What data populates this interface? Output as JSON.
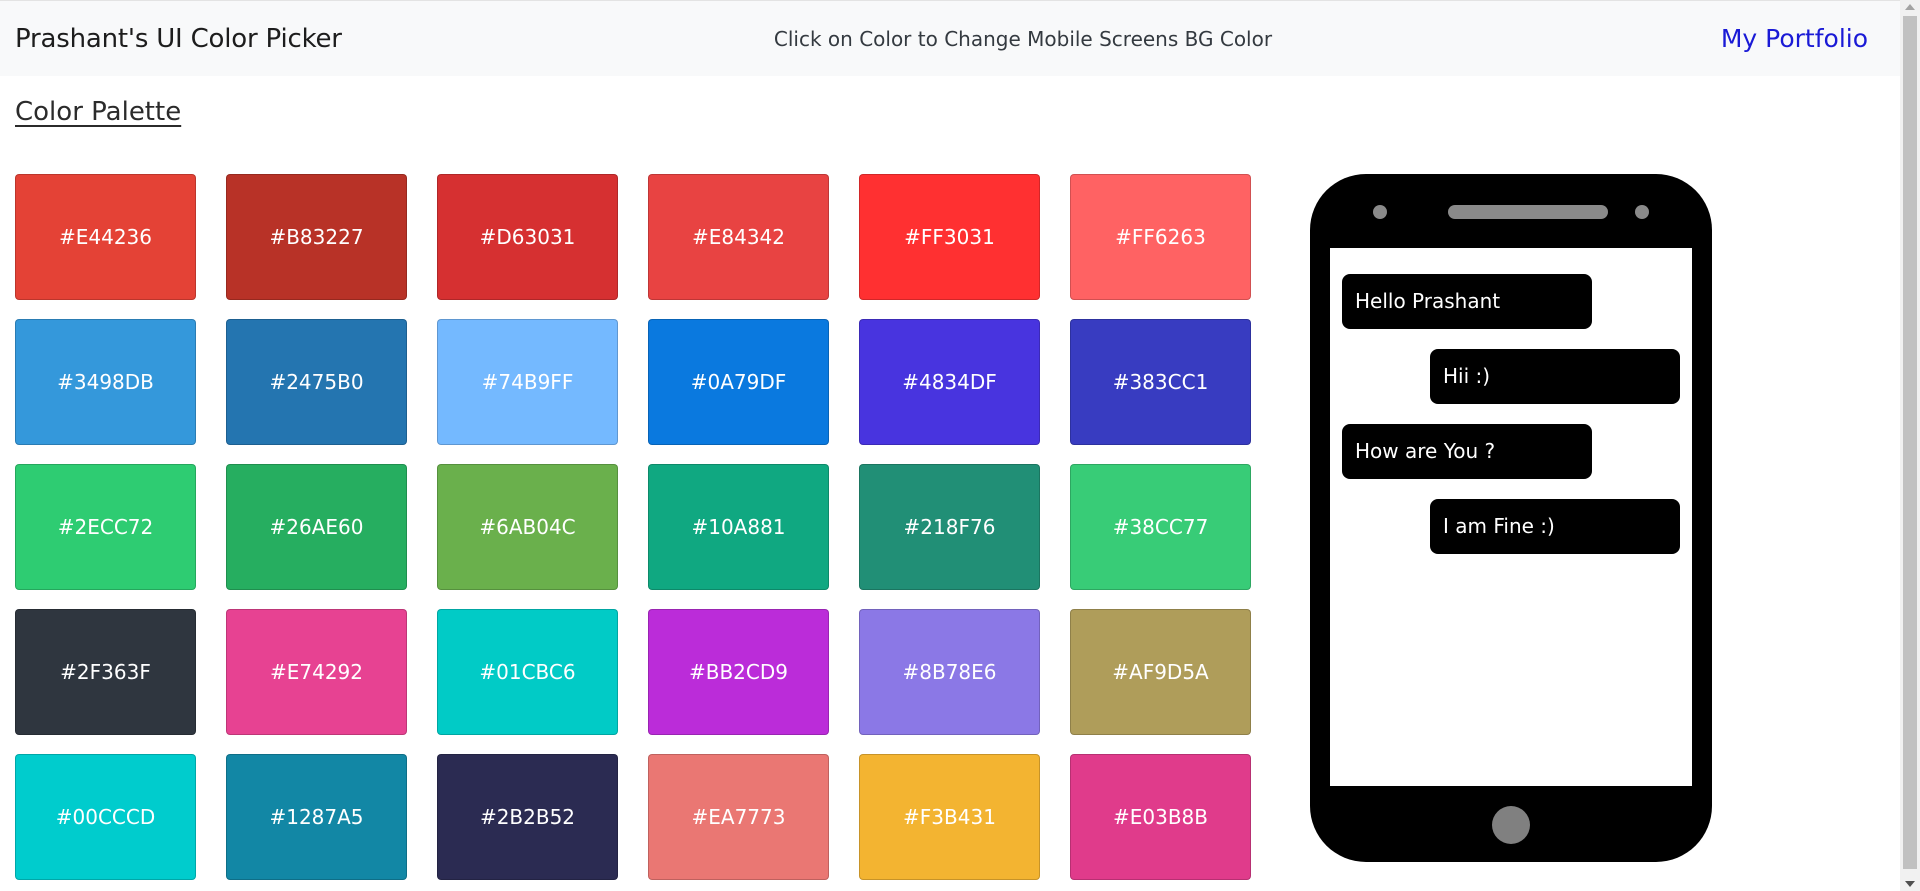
{
  "header": {
    "brand": "Prashant's UI Color Picker",
    "message": "Click on Color to Change Mobile Screens BG Color",
    "portfolio_link": "My Portfolio"
  },
  "palette": {
    "title": "Color Palette",
    "colors": [
      "#E44236",
      "#B83227",
      "#D63031",
      "#E84342",
      "#FF3031",
      "#FF6263",
      "#3498DB",
      "#2475B0",
      "#74B9FF",
      "#0A79DF",
      "#4834DF",
      "#383CC1",
      "#2ECC72",
      "#26AE60",
      "#6AB04C",
      "#10A881",
      "#218F76",
      "#38CC77",
      "#2F363F",
      "#E74292",
      "#01CBC6",
      "#BB2CD9",
      "#8B78E6",
      "#AF9D5A",
      "#00CCCD",
      "#1287A5",
      "#2B2B52",
      "#EA7773",
      "#F3B431",
      "#E03B8B"
    ]
  },
  "phone": {
    "screen_bg": "#FFFFFF",
    "messages": [
      "Hello Prashant",
      "Hii :)",
      "How are You ?",
      "I am Fine :)"
    ]
  }
}
